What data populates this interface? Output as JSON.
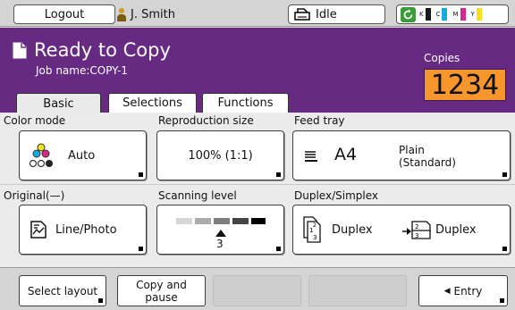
{
  "topbar": {
    "logout_label": "Logout",
    "user_name": "J. Smith",
    "status_text": "Idle",
    "ink": [
      {
        "label": "K",
        "color": "#1a1a1a"
      },
      {
        "label": "C",
        "color": "#19a9e1"
      },
      {
        "label": "M",
        "color": "#d8278b"
      },
      {
        "label": "Y",
        "color": "#f4e11a"
      }
    ]
  },
  "header": {
    "title": "Ready to Copy",
    "job_name": "Job name:COPY-1",
    "copies_label": "Copies",
    "copies_value": "1234",
    "accent_color": "#672a83",
    "copies_color": "#f7962d"
  },
  "tabs": [
    {
      "label": "Basic",
      "active": true
    },
    {
      "label": "Selections",
      "active": false
    },
    {
      "label": "Functions",
      "active": false
    }
  ],
  "settings": {
    "color_mode": {
      "label": "Color mode",
      "value": "Auto",
      "icon": "color-mode-icon"
    },
    "reproduction_size": {
      "label": "Reproduction size",
      "value": "100% (1:1)"
    },
    "feed_tray": {
      "label": "Feed tray",
      "size": "A4",
      "paper_line1": "Plain",
      "paper_line2": "(Standard)",
      "icon": "tray-icon"
    },
    "original": {
      "label": "Original(—)",
      "value": "Line/Photo",
      "icon": "line-photo-icon"
    },
    "scanning_level": {
      "label": "Scanning level",
      "value": "3",
      "level": 3
    },
    "duplex": {
      "label": "Duplex/Simplex",
      "from": "Duplex",
      "to": "Duplex"
    }
  },
  "bottom": {
    "select_layout": "Select layout",
    "copy_pause_line1": "Copy and",
    "copy_pause_line2": "pause",
    "entry": "Entry"
  }
}
